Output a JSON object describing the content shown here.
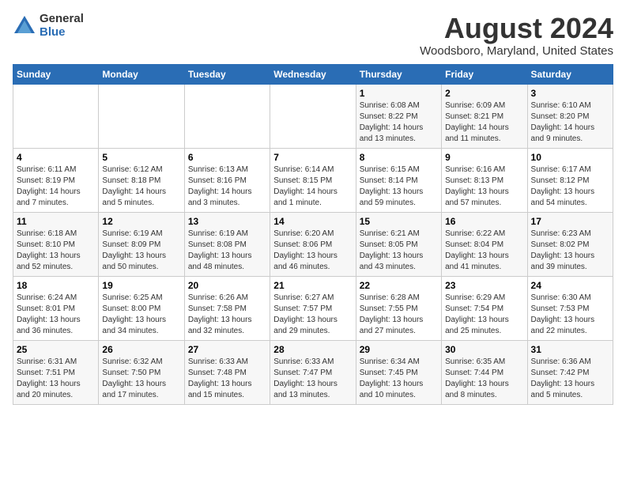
{
  "logo": {
    "general": "General",
    "blue": "Blue"
  },
  "title": "August 2024",
  "subtitle": "Woodsboro, Maryland, United States",
  "days_of_week": [
    "Sunday",
    "Monday",
    "Tuesday",
    "Wednesday",
    "Thursday",
    "Friday",
    "Saturday"
  ],
  "weeks": [
    [
      {
        "day": "",
        "info": ""
      },
      {
        "day": "",
        "info": ""
      },
      {
        "day": "",
        "info": ""
      },
      {
        "day": "",
        "info": ""
      },
      {
        "day": "1",
        "info": "Sunrise: 6:08 AM\nSunset: 8:22 PM\nDaylight: 14 hours\nand 13 minutes."
      },
      {
        "day": "2",
        "info": "Sunrise: 6:09 AM\nSunset: 8:21 PM\nDaylight: 14 hours\nand 11 minutes."
      },
      {
        "day": "3",
        "info": "Sunrise: 6:10 AM\nSunset: 8:20 PM\nDaylight: 14 hours\nand 9 minutes."
      }
    ],
    [
      {
        "day": "4",
        "info": "Sunrise: 6:11 AM\nSunset: 8:19 PM\nDaylight: 14 hours\nand 7 minutes."
      },
      {
        "day": "5",
        "info": "Sunrise: 6:12 AM\nSunset: 8:18 PM\nDaylight: 14 hours\nand 5 minutes."
      },
      {
        "day": "6",
        "info": "Sunrise: 6:13 AM\nSunset: 8:16 PM\nDaylight: 14 hours\nand 3 minutes."
      },
      {
        "day": "7",
        "info": "Sunrise: 6:14 AM\nSunset: 8:15 PM\nDaylight: 14 hours\nand 1 minute."
      },
      {
        "day": "8",
        "info": "Sunrise: 6:15 AM\nSunset: 8:14 PM\nDaylight: 13 hours\nand 59 minutes."
      },
      {
        "day": "9",
        "info": "Sunrise: 6:16 AM\nSunset: 8:13 PM\nDaylight: 13 hours\nand 57 minutes."
      },
      {
        "day": "10",
        "info": "Sunrise: 6:17 AM\nSunset: 8:12 PM\nDaylight: 13 hours\nand 54 minutes."
      }
    ],
    [
      {
        "day": "11",
        "info": "Sunrise: 6:18 AM\nSunset: 8:10 PM\nDaylight: 13 hours\nand 52 minutes."
      },
      {
        "day": "12",
        "info": "Sunrise: 6:19 AM\nSunset: 8:09 PM\nDaylight: 13 hours\nand 50 minutes."
      },
      {
        "day": "13",
        "info": "Sunrise: 6:19 AM\nSunset: 8:08 PM\nDaylight: 13 hours\nand 48 minutes."
      },
      {
        "day": "14",
        "info": "Sunrise: 6:20 AM\nSunset: 8:06 PM\nDaylight: 13 hours\nand 46 minutes."
      },
      {
        "day": "15",
        "info": "Sunrise: 6:21 AM\nSunset: 8:05 PM\nDaylight: 13 hours\nand 43 minutes."
      },
      {
        "day": "16",
        "info": "Sunrise: 6:22 AM\nSunset: 8:04 PM\nDaylight: 13 hours\nand 41 minutes."
      },
      {
        "day": "17",
        "info": "Sunrise: 6:23 AM\nSunset: 8:02 PM\nDaylight: 13 hours\nand 39 minutes."
      }
    ],
    [
      {
        "day": "18",
        "info": "Sunrise: 6:24 AM\nSunset: 8:01 PM\nDaylight: 13 hours\nand 36 minutes."
      },
      {
        "day": "19",
        "info": "Sunrise: 6:25 AM\nSunset: 8:00 PM\nDaylight: 13 hours\nand 34 minutes."
      },
      {
        "day": "20",
        "info": "Sunrise: 6:26 AM\nSunset: 7:58 PM\nDaylight: 13 hours\nand 32 minutes."
      },
      {
        "day": "21",
        "info": "Sunrise: 6:27 AM\nSunset: 7:57 PM\nDaylight: 13 hours\nand 29 minutes."
      },
      {
        "day": "22",
        "info": "Sunrise: 6:28 AM\nSunset: 7:55 PM\nDaylight: 13 hours\nand 27 minutes."
      },
      {
        "day": "23",
        "info": "Sunrise: 6:29 AM\nSunset: 7:54 PM\nDaylight: 13 hours\nand 25 minutes."
      },
      {
        "day": "24",
        "info": "Sunrise: 6:30 AM\nSunset: 7:53 PM\nDaylight: 13 hours\nand 22 minutes."
      }
    ],
    [
      {
        "day": "25",
        "info": "Sunrise: 6:31 AM\nSunset: 7:51 PM\nDaylight: 13 hours\nand 20 minutes."
      },
      {
        "day": "26",
        "info": "Sunrise: 6:32 AM\nSunset: 7:50 PM\nDaylight: 13 hours\nand 17 minutes."
      },
      {
        "day": "27",
        "info": "Sunrise: 6:33 AM\nSunset: 7:48 PM\nDaylight: 13 hours\nand 15 minutes."
      },
      {
        "day": "28",
        "info": "Sunrise: 6:33 AM\nSunset: 7:47 PM\nDaylight: 13 hours\nand 13 minutes."
      },
      {
        "day": "29",
        "info": "Sunrise: 6:34 AM\nSunset: 7:45 PM\nDaylight: 13 hours\nand 10 minutes."
      },
      {
        "day": "30",
        "info": "Sunrise: 6:35 AM\nSunset: 7:44 PM\nDaylight: 13 hours\nand 8 minutes."
      },
      {
        "day": "31",
        "info": "Sunrise: 6:36 AM\nSunset: 7:42 PM\nDaylight: 13 hours\nand 5 minutes."
      }
    ]
  ]
}
